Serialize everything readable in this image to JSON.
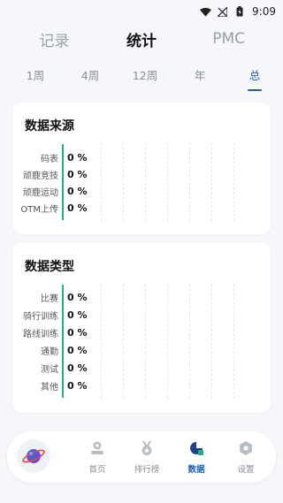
{
  "status": {
    "time": "9:09"
  },
  "top_tabs": [
    {
      "label": "记录"
    },
    {
      "label": "统计"
    },
    {
      "label": "PMC"
    }
  ],
  "periods": [
    {
      "label": "1周"
    },
    {
      "label": "4周"
    },
    {
      "label": "12周"
    },
    {
      "label": "年"
    },
    {
      "label": "总"
    }
  ],
  "source_card": {
    "title": "数据来源",
    "rows": [
      {
        "label": "码表",
        "value": "0 %"
      },
      {
        "label": "顽鹿竞技",
        "value": "0 %"
      },
      {
        "label": "顽鹿运动",
        "value": "0 %"
      },
      {
        "label": "OTM上传",
        "value": "0 %"
      }
    ]
  },
  "type_card": {
    "title": "数据类型",
    "rows": [
      {
        "label": "比赛",
        "value": "0 %"
      },
      {
        "label": "骑行训练",
        "value": "0 %"
      },
      {
        "label": "路线训练",
        "value": "0 %"
      },
      {
        "label": "通勤",
        "value": "0 %"
      },
      {
        "label": "测试",
        "value": "0 %"
      },
      {
        "label": "其他",
        "value": "0 %"
      }
    ]
  },
  "bottom_nav": [
    {
      "label": "首页",
      "icon": "home-icon"
    },
    {
      "label": "排行榜",
      "icon": "medal-icon"
    },
    {
      "label": "数据",
      "icon": "data-icon"
    },
    {
      "label": "设置",
      "icon": "gear-icon"
    }
  ],
  "colors": {
    "accent": "#1f5fb0",
    "axis": "#1fb08a",
    "background": "#f5f7fa"
  }
}
